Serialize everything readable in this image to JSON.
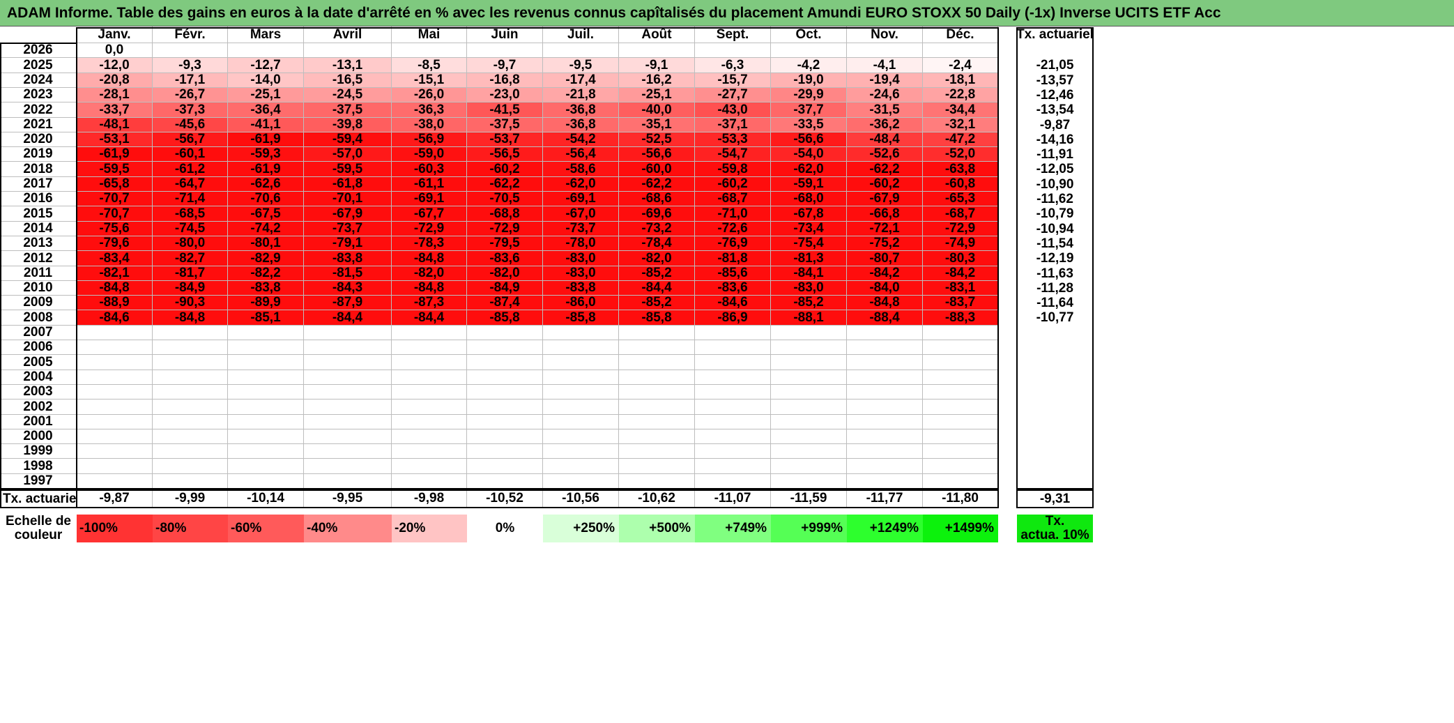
{
  "title": "ADAM Informe. Table des gains en euros à la date d'arrêté en % avec les revenus connus capîtalisés du placement Amundi EURO STOXX 50 Daily (-1x) Inverse UCITS ETF Acc",
  "months": [
    "Janv.",
    "Févr.",
    "Mars",
    "Avril",
    "Mai",
    "Juin",
    "Juil.",
    "Août",
    "Sept.",
    "Oct.",
    "Nov.",
    "Déc."
  ],
  "rate_header": "Tx. actuariel",
  "rows": [
    {
      "year": "2026",
      "values": [
        "0,0",
        "",
        "",
        "",
        "",
        "",
        "",
        "",
        "",
        "",
        "",
        ""
      ],
      "rate": ""
    },
    {
      "year": "2025",
      "values": [
        "-12,0",
        "-9,3",
        "-12,7",
        "-13,1",
        "-8,5",
        "-9,7",
        "-9,5",
        "-9,1",
        "-6,3",
        "-4,2",
        "-4,1",
        "-2,4"
      ],
      "rate": "-21,05"
    },
    {
      "year": "2024",
      "values": [
        "-20,8",
        "-17,1",
        "-14,0",
        "-16,5",
        "-15,1",
        "-16,8",
        "-17,4",
        "-16,2",
        "-15,7",
        "-19,0",
        "-19,4",
        "-18,1"
      ],
      "rate": "-13,57"
    },
    {
      "year": "2023",
      "values": [
        "-28,1",
        "-26,7",
        "-25,1",
        "-24,5",
        "-26,0",
        "-23,0",
        "-21,8",
        "-25,1",
        "-27,7",
        "-29,9",
        "-24,6",
        "-22,8"
      ],
      "rate": "-12,46"
    },
    {
      "year": "2022",
      "values": [
        "-33,7",
        "-37,3",
        "-36,4",
        "-37,5",
        "-36,3",
        "-41,5",
        "-36,8",
        "-40,0",
        "-43,0",
        "-37,7",
        "-31,5",
        "-34,4"
      ],
      "rate": "-13,54"
    },
    {
      "year": "2021",
      "values": [
        "-48,1",
        "-45,6",
        "-41,1",
        "-39,8",
        "-38,0",
        "-37,5",
        "-36,8",
        "-35,1",
        "-37,1",
        "-33,5",
        "-36,2",
        "-32,1"
      ],
      "rate": "-9,87"
    },
    {
      "year": "2020",
      "values": [
        "-53,1",
        "-56,7",
        "-61,9",
        "-59,4",
        "-56,9",
        "-53,7",
        "-54,2",
        "-52,5",
        "-53,3",
        "-56,6",
        "-48,4",
        "-47,2"
      ],
      "rate": "-14,16"
    },
    {
      "year": "2019",
      "values": [
        "-61,9",
        "-60,1",
        "-59,3",
        "-57,0",
        "-59,0",
        "-56,5",
        "-56,4",
        "-56,6",
        "-54,7",
        "-54,0",
        "-52,6",
        "-52,0"
      ],
      "rate": "-11,91"
    },
    {
      "year": "2018",
      "values": [
        "-59,5",
        "-61,2",
        "-61,9",
        "-59,5",
        "-60,3",
        "-60,2",
        "-58,6",
        "-60,0",
        "-59,8",
        "-62,0",
        "-62,2",
        "-63,8"
      ],
      "rate": "-12,05"
    },
    {
      "year": "2017",
      "values": [
        "-65,8",
        "-64,7",
        "-62,6",
        "-61,8",
        "-61,1",
        "-62,2",
        "-62,0",
        "-62,2",
        "-60,2",
        "-59,1",
        "-60,2",
        "-60,8"
      ],
      "rate": "-10,90"
    },
    {
      "year": "2016",
      "values": [
        "-70,7",
        "-71,4",
        "-70,6",
        "-70,1",
        "-69,1",
        "-70,5",
        "-69,1",
        "-68,6",
        "-68,7",
        "-68,0",
        "-67,9",
        "-65,3"
      ],
      "rate": "-11,62"
    },
    {
      "year": "2015",
      "values": [
        "-70,7",
        "-68,5",
        "-67,5",
        "-67,9",
        "-67,7",
        "-68,8",
        "-67,0",
        "-69,6",
        "-71,0",
        "-67,8",
        "-66,8",
        "-68,7"
      ],
      "rate": "-10,79"
    },
    {
      "year": "2014",
      "values": [
        "-75,6",
        "-74,5",
        "-74,2",
        "-73,7",
        "-72,9",
        "-72,9",
        "-73,7",
        "-73,2",
        "-72,6",
        "-73,4",
        "-72,1",
        "-72,9"
      ],
      "rate": "-10,94"
    },
    {
      "year": "2013",
      "values": [
        "-79,6",
        "-80,0",
        "-80,1",
        "-79,1",
        "-78,3",
        "-79,5",
        "-78,0",
        "-78,4",
        "-76,9",
        "-75,4",
        "-75,2",
        "-74,9"
      ],
      "rate": "-11,54"
    },
    {
      "year": "2012",
      "values": [
        "-83,4",
        "-82,7",
        "-82,9",
        "-83,8",
        "-84,8",
        "-83,6",
        "-83,0",
        "-82,0",
        "-81,8",
        "-81,3",
        "-80,7",
        "-80,3"
      ],
      "rate": "-12,19"
    },
    {
      "year": "2011",
      "values": [
        "-82,1",
        "-81,7",
        "-82,2",
        "-81,5",
        "-82,0",
        "-82,0",
        "-83,0",
        "-85,2",
        "-85,6",
        "-84,1",
        "-84,2",
        "-84,2"
      ],
      "rate": "-11,63"
    },
    {
      "year": "2010",
      "values": [
        "-84,8",
        "-84,9",
        "-83,8",
        "-84,3",
        "-84,8",
        "-84,9",
        "-83,8",
        "-84,4",
        "-83,6",
        "-83,0",
        "-84,0",
        "-83,1"
      ],
      "rate": "-11,28"
    },
    {
      "year": "2009",
      "values": [
        "-88,9",
        "-90,3",
        "-89,9",
        "-87,9",
        "-87,3",
        "-87,4",
        "-86,0",
        "-85,2",
        "-84,6",
        "-85,2",
        "-84,8",
        "-83,7"
      ],
      "rate": "-11,64"
    },
    {
      "year": "2008",
      "values": [
        "-84,6",
        "-84,8",
        "-85,1",
        "-84,4",
        "-84,4",
        "-85,8",
        "-85,8",
        "-85,8",
        "-86,9",
        "-88,1",
        "-88,4",
        "-88,3"
      ],
      "rate": "-10,77"
    },
    {
      "year": "2007",
      "values": [
        "",
        "",
        "",
        "",
        "",
        "",
        "",
        "",
        "",
        "",
        "",
        ""
      ],
      "rate": ""
    },
    {
      "year": "2006",
      "values": [
        "",
        "",
        "",
        "",
        "",
        "",
        "",
        "",
        "",
        "",
        "",
        ""
      ],
      "rate": ""
    },
    {
      "year": "2005",
      "values": [
        "",
        "",
        "",
        "",
        "",
        "",
        "",
        "",
        "",
        "",
        "",
        ""
      ],
      "rate": ""
    },
    {
      "year": "2004",
      "values": [
        "",
        "",
        "",
        "",
        "",
        "",
        "",
        "",
        "",
        "",
        "",
        ""
      ],
      "rate": ""
    },
    {
      "year": "2003",
      "values": [
        "",
        "",
        "",
        "",
        "",
        "",
        "",
        "",
        "",
        "",
        "",
        ""
      ],
      "rate": ""
    },
    {
      "year": "2002",
      "values": [
        "",
        "",
        "",
        "",
        "",
        "",
        "",
        "",
        "",
        "",
        "",
        ""
      ],
      "rate": ""
    },
    {
      "year": "2001",
      "values": [
        "",
        "",
        "",
        "",
        "",
        "",
        "",
        "",
        "",
        "",
        "",
        ""
      ],
      "rate": ""
    },
    {
      "year": "2000",
      "values": [
        "",
        "",
        "",
        "",
        "",
        "",
        "",
        "",
        "",
        "",
        "",
        ""
      ],
      "rate": ""
    },
    {
      "year": "1999",
      "values": [
        "",
        "",
        "",
        "",
        "",
        "",
        "",
        "",
        "",
        "",
        "",
        ""
      ],
      "rate": ""
    },
    {
      "year": "1998",
      "values": [
        "",
        "",
        "",
        "",
        "",
        "",
        "",
        "",
        "",
        "",
        "",
        ""
      ],
      "rate": ""
    },
    {
      "year": "1997",
      "values": [
        "",
        "",
        "",
        "",
        "",
        "",
        "",
        "",
        "",
        "",
        "",
        ""
      ],
      "rate": ""
    }
  ],
  "summary": {
    "label": "Tx. actuariel",
    "values": [
      "-9,87",
      "-9,99",
      "-10,14",
      "-9,95",
      "-9,98",
      "-10,52",
      "-10,56",
      "-10,62",
      "-11,07",
      "-11,59",
      "-11,77",
      "-11,80"
    ],
    "rate": "-9,31"
  },
  "legend": {
    "label_line1": "Echelle de",
    "label_line2": "couleur",
    "items": [
      {
        "text": "-100%",
        "color": "#ff3333"
      },
      {
        "text": "-80%",
        "color": "#ff4545"
      },
      {
        "text": "-60%",
        "color": "#ff5a5a"
      },
      {
        "text": "-40%",
        "color": "#ff8a8a"
      },
      {
        "text": "-20%",
        "color": "#ffc4c4"
      },
      {
        "text": "0%",
        "color": "#ffffff"
      },
      {
        "text": "+250%",
        "color": "#d9ffd9"
      },
      {
        "text": "+500%",
        "color": "#adffad"
      },
      {
        "text": "+749%",
        "color": "#80ff80"
      },
      {
        "text": "+999%",
        "color": "#55ff55"
      },
      {
        "text": "+1249%",
        "color": "#2dff2d"
      },
      {
        "text": "+1499%",
        "color": "#0cf20c"
      }
    ],
    "rate_line1": "Tx.",
    "rate_line2": "actua. 10%",
    "rate_color": "#0fe80f"
  },
  "colors": {
    "title_bg": "#7fc97f",
    "neg_full": "#ff0000"
  }
}
